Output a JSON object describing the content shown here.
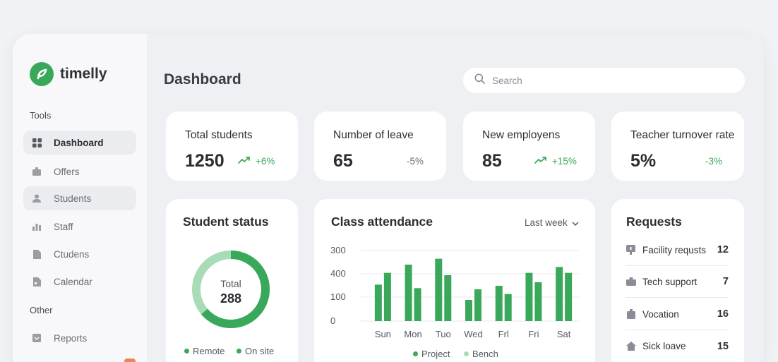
{
  "app": {
    "name": "timelly"
  },
  "sidebar": {
    "sections": [
      {
        "label": "Tools"
      },
      {
        "label": "Other"
      }
    ],
    "items": [
      {
        "label": "Dashboard",
        "icon": "grid-icon"
      },
      {
        "label": "Offers",
        "icon": "briefcase-icon"
      },
      {
        "label": "Students",
        "icon": "user-icon"
      },
      {
        "label": "Staff",
        "icon": "bar-chart-icon"
      },
      {
        "label": "Ctudens",
        "icon": "document-icon"
      },
      {
        "label": "Calendar",
        "icon": "calendar-icon"
      },
      {
        "label": "Reports",
        "icon": "report-icon"
      }
    ]
  },
  "header": {
    "title": "Dashboard",
    "search_placeholder": "Search"
  },
  "stats": [
    {
      "label": "Total students",
      "value": "1250",
      "change": "+6%",
      "trend": "up"
    },
    {
      "label": "Number of leave",
      "value": "65",
      "change": "-5%",
      "trend": "down"
    },
    {
      "label": "New employens",
      "value": "85",
      "change": "+15%",
      "trend": "up"
    },
    {
      "label": "Teacher turnover rate",
      "value": "5%",
      "change": "-3%",
      "trend": "down"
    }
  ],
  "student_status": {
    "title": "Student status",
    "center_label": "Total",
    "center_value": "288",
    "legend": [
      "Remote",
      "On site"
    ]
  },
  "attendance": {
    "title": "Class attendance",
    "period": "Last week"
  },
  "chart_data": {
    "type": "bar",
    "title": "Class attendance",
    "categories": [
      "Sun",
      "Mon",
      "Tuo",
      "Wed",
      "Frl",
      "Fri",
      "Sat"
    ],
    "series": [
      {
        "name": "Project",
        "values": [
          155,
          240,
          265,
          90,
          150,
          205,
          230
        ]
      },
      {
        "name": "Bench",
        "values": [
          205,
          140,
          195,
          135,
          115,
          165,
          205
        ]
      }
    ],
    "y_ticks": [
      "300",
      "400",
      "100",
      "0"
    ],
    "ylim": [
      0,
      300
    ],
    "grid": true,
    "legend": "bottom"
  },
  "requests": {
    "title": "Requests",
    "items": [
      {
        "label": "Facility requsts",
        "count": "12",
        "icon": "bell-icon"
      },
      {
        "label": "Tech support",
        "count": "7",
        "icon": "briefcase-icon"
      },
      {
        "label": "Vocation",
        "count": "16",
        "icon": "suitcase-icon"
      },
      {
        "label": "Sick loave",
        "count": "15",
        "icon": "home-icon"
      }
    ]
  },
  "colors": {
    "accent": "#3aa85a",
    "accent_light": "#a8dcb6",
    "background": "#eff0f3",
    "card": "#ffffff"
  }
}
